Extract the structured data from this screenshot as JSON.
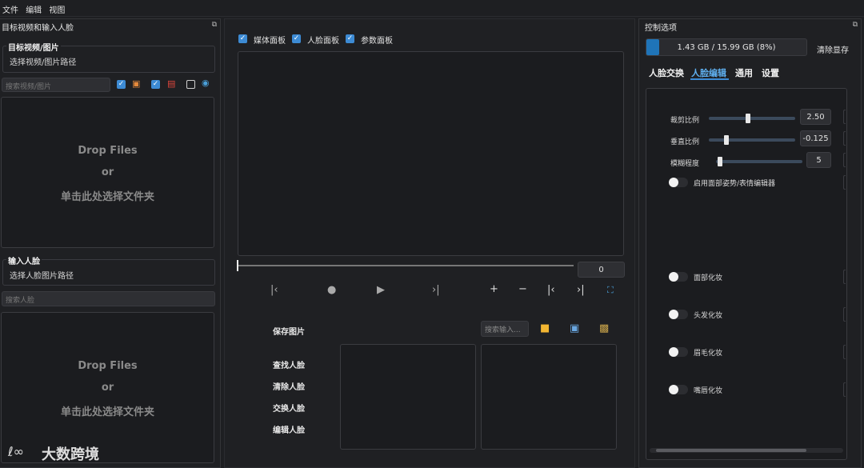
{
  "menubar": {
    "file": "文件",
    "edit": "编辑",
    "view": "视图"
  },
  "left_dock": {
    "title": "目标视频和输入人脸",
    "float_icon": "⧉",
    "target_group": {
      "label": "目标视频/图片",
      "path": "选择视频/图片路径"
    },
    "target_search_placeholder": "搜索视频/图片",
    "target_drop": {
      "line1": "Drop Files",
      "line2": "or",
      "line3": "单击此处选择文件夹"
    },
    "face_group": {
      "label": "输入人脸",
      "path": "选择人脸图片路径"
    },
    "face_search_placeholder": "搜索人脸",
    "face_drop": {
      "line1": "Drop Files",
      "line2": "or",
      "line3": "单击此处选择文件夹"
    }
  },
  "center": {
    "media_panel_label": "媒体面板",
    "face_panel_label": "人脸面板",
    "param_panel_label": "参数面板",
    "frame_value": "0",
    "save_image_label": "保存图片",
    "search_input_placeholder": "搜索输入...",
    "find_faces": "查找人脸",
    "clear_faces": "清除人脸",
    "swap_faces": "交换人脸",
    "edit_faces": "编辑人脸"
  },
  "right_dock": {
    "title": "控制选项",
    "float_icon": "⧉",
    "vram_text": "1.43 GB / 15.99 GB (8%)",
    "vram_fraction": 0.08,
    "clear_vram": "清除显存",
    "tabs": [
      "人脸交换",
      "人脸编辑",
      "通用",
      "设置"
    ],
    "active_tab": "人脸编辑",
    "sliders": [
      {
        "label": "裁剪比例",
        "value": "2.50",
        "fraction": 0.45
      },
      {
        "label": "垂直比例",
        "value": "-0.125",
        "fraction": 0.2
      },
      {
        "label": "模糊程度",
        "value": "5",
        "fraction": 0.05
      }
    ],
    "toggles": {
      "face_pose": "启用面部姿势/表情编辑器",
      "face_makeup": "面部化妆",
      "hair_makeup": "头发化妆",
      "brow_makeup": "眉毛化妆",
      "lip_makeup": "嘴唇化妆"
    }
  },
  "watermark": {
    "text": "大数跨境"
  },
  "colors": {
    "accent": "#3d8bd4",
    "background": "#1e1f22"
  }
}
